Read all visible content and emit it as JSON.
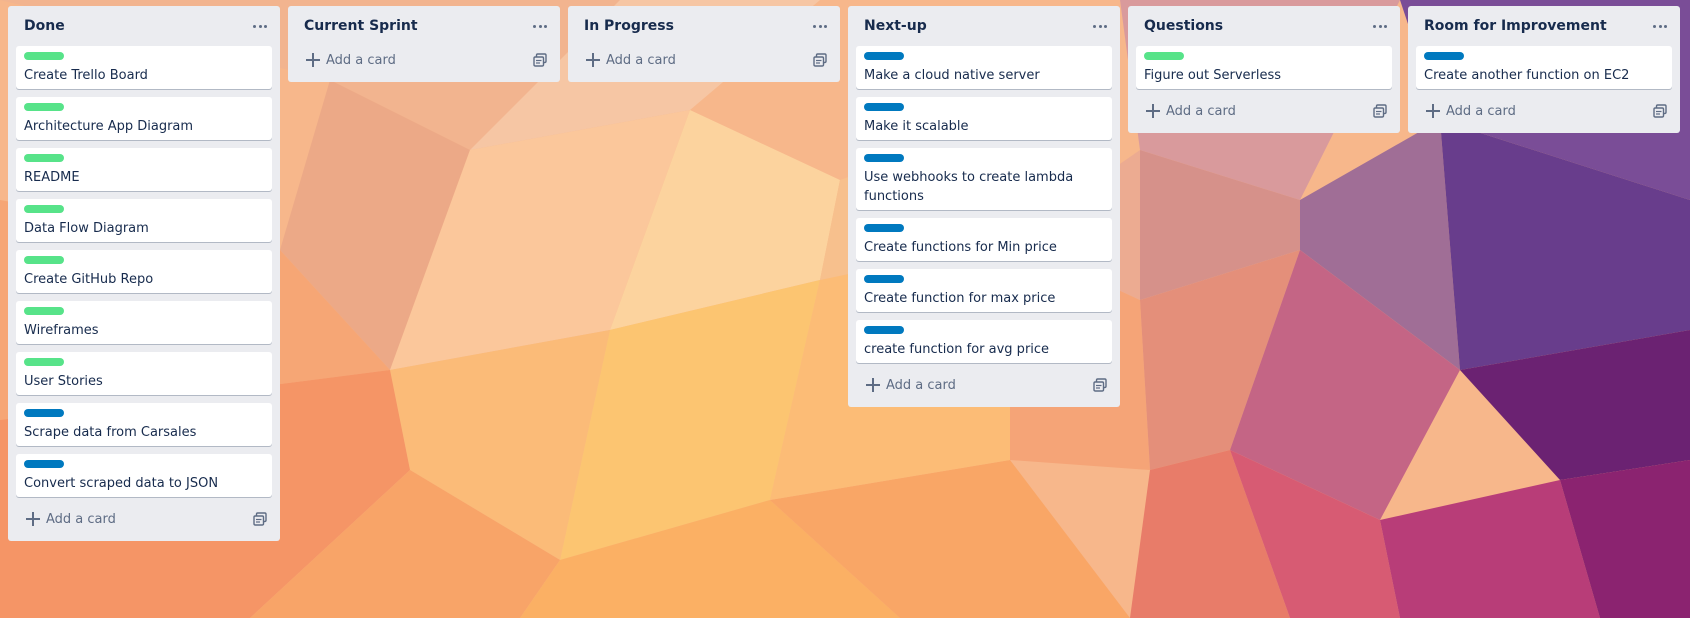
{
  "colors": {
    "label_green": "#61bd4f",
    "label_teal": "#57e389",
    "label_blue": "#0079bf"
  },
  "add_card_label": "Add a card",
  "lists": [
    {
      "title": "Done",
      "cards": [
        {
          "title": "Create Trello Board",
          "label": "green"
        },
        {
          "title": "Architecture App Diagram",
          "label": "green"
        },
        {
          "title": "README",
          "label": "green"
        },
        {
          "title": "Data Flow Diagram",
          "label": "green"
        },
        {
          "title": "Create GitHub Repo",
          "label": "green"
        },
        {
          "title": "Wireframes",
          "label": "green"
        },
        {
          "title": "User Stories",
          "label": "green"
        },
        {
          "title": "Scrape data from Carsales",
          "label": "blue"
        },
        {
          "title": "Convert scraped data to JSON",
          "label": "blue"
        }
      ]
    },
    {
      "title": "Current Sprint",
      "cards": []
    },
    {
      "title": "In Progress",
      "cards": []
    },
    {
      "title": "Next-up",
      "cards": [
        {
          "title": "Make a cloud native server",
          "label": "blue"
        },
        {
          "title": "Make it scalable",
          "label": "blue"
        },
        {
          "title": "Use webhooks to create lambda functions",
          "label": "blue"
        },
        {
          "title": "Create functions for Min price",
          "label": "blue"
        },
        {
          "title": "Create function for max price",
          "label": "blue"
        },
        {
          "title": "create function for avg price",
          "label": "blue"
        }
      ]
    },
    {
      "title": "Questions",
      "cards": [
        {
          "title": "Figure out Serverless",
          "label": "green"
        }
      ]
    },
    {
      "title": "Room for Improvement",
      "cards": [
        {
          "title": "Create another function on EC2",
          "label": "blue"
        }
      ]
    }
  ]
}
